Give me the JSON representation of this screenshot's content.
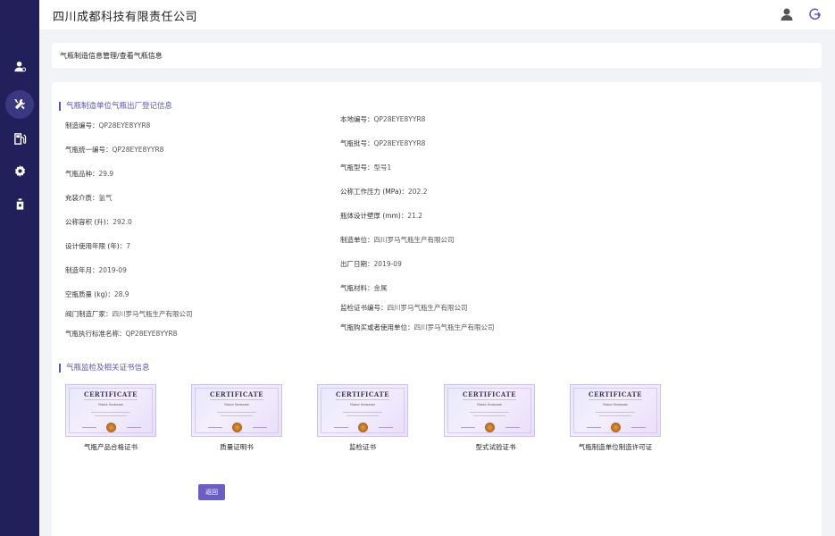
{
  "header": {
    "company": "四川成都科技有限责任公司"
  },
  "breadcrumb": "气瓶制造信息管理/查看气瓶信息",
  "sidebar": {
    "items": [
      {
        "icon": "user-icon"
      },
      {
        "icon": "tools-icon",
        "active": true
      },
      {
        "icon": "gas-station-icon"
      },
      {
        "icon": "gear-icon"
      },
      {
        "icon": "cylinder-icon"
      }
    ]
  },
  "section1": {
    "title": "气瓶制造单位气瓶出厂登记信息"
  },
  "fields_left": [
    {
      "label": "制造编号：",
      "value": "QP28EYE8YYR8"
    },
    {
      "label": "气瓶统一编号：",
      "value": "QP28EYE8YYR8"
    },
    {
      "label": "气瓶品种：",
      "value": "29.9"
    },
    {
      "label": "充装介质：",
      "value": "氢气"
    },
    {
      "label": "公称容积 (升)：",
      "value": "292.0"
    },
    {
      "label": "设计使用年限 (年)：",
      "value": "7"
    },
    {
      "label": "制造年月：",
      "value": "2019-09"
    },
    {
      "label": "空瓶质量 (kg)：",
      "value": "28.9"
    },
    {
      "label": "阀门制造厂家：",
      "value": "四川罗马气瓶生产有限公司"
    },
    {
      "label": "气瓶执行标准名称：",
      "value": "QP28EYE8YYR8"
    }
  ],
  "fields_right": [
    {
      "label": "本地编号：",
      "value": "QP28EYE8YYR8"
    },
    {
      "label": "气瓶批号：",
      "value": "QP28EYE8YYR8"
    },
    {
      "label": "气瓶型号：",
      "value": "型号1"
    },
    {
      "label": "公称工作压力 (MPa)：",
      "value": "202.2"
    },
    {
      "label": "瓶体设计壁厚 (mm)：",
      "value": "21.2"
    },
    {
      "label": "制造单位：",
      "value": "四川罗马气瓶生产有限公司"
    },
    {
      "label": "出厂日期：",
      "value": "2019-09"
    },
    {
      "label": "气瓶材料：",
      "value": "金属"
    },
    {
      "label": "监检证书编号：",
      "value": "四川罗马气瓶生产有限公司"
    },
    {
      "label": "气瓶购买或者使用单位：",
      "value": "四川罗马气瓶生产有限公司"
    }
  ],
  "section2": {
    "title": "气瓶监检及相关证书信息"
  },
  "certificates": [
    {
      "image_title": "CERTIFICATE",
      "image_name": "Name Surname",
      "label": "气瓶产品合格证书"
    },
    {
      "image_title": "CERTIFICATE",
      "image_name": "Name Surname",
      "label": "质量证明书"
    },
    {
      "image_title": "CERTIFICATE",
      "image_name": "Name Surname",
      "label": "监检证书"
    },
    {
      "image_title": "CERTIFICATE",
      "image_name": "Name Surname",
      "label": "型式试验证书"
    },
    {
      "image_title": "CERTIFICATE",
      "image_name": "Name Surname",
      "label": "气瓶制造单位制造许可证"
    }
  ],
  "back_button": "返回"
}
